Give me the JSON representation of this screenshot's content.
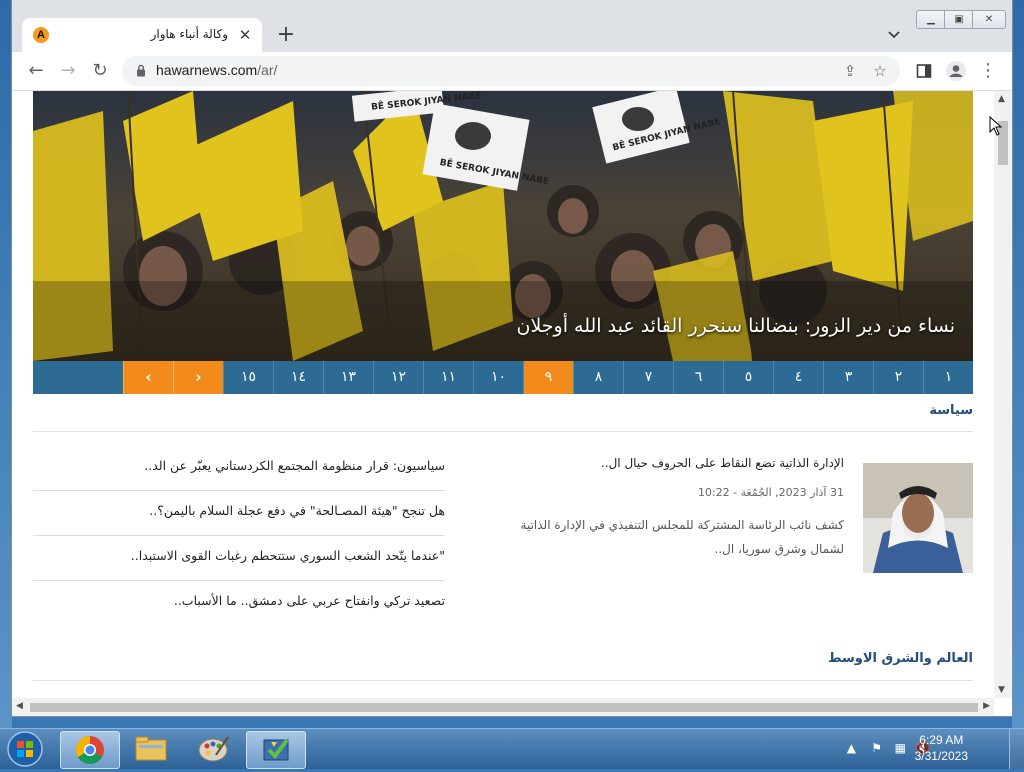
{
  "browser": {
    "tab_title": "وكالة أنباء هاوار",
    "favicon_letter": "A",
    "url_host": "hawarnews.com",
    "url_path": "/ar/"
  },
  "hero": {
    "caption": "نساء من دير الزور: بنضالنا سنحرر القائد عبد الله أوجلان",
    "sign_text": [
      "BÊ SEROK JIYAN NABE",
      "BÊ SEROK JIYAN NABE",
      "BÊ SEROK JIYAN NABE"
    ],
    "pager": [
      "١",
      "٢",
      "٣",
      "٤",
      "٥",
      "٦",
      "٧",
      "٨",
      "٩",
      "١٠",
      "١١",
      "١٢",
      "١٣",
      "١٤",
      "١٥"
    ],
    "active_page": "٩",
    "next_label": "›",
    "prev_label": "‹",
    "colors": {
      "accent": "#f28a1c",
      "pager_bg": "#2e6b94"
    }
  },
  "politics": {
    "title": "سياسة",
    "feature": {
      "title": "الإدارة الذاتية تضع النقاط على الحروف حيال ال..",
      "date": "31 آذار 2023, الجُمُعَة - 10:22",
      "summary": "كشف نائب الرئاسة المشتركة للمجلس التنفيذي في الإدارة الذاتية لشمال وشرق سوريا، ال.."
    },
    "list": [
      "سياسيون: قرار منظومة المجتمع الكردستاني يعبّر عن الد..",
      "هل تنجح \"هيئة المصـالحة\" في دفع عجلة السلام باليمن؟..",
      "\"عندما يتّحد الشعب السوري ستتحطم رغبات القوى الاستبدا..",
      "تصعيد تركي وانفتاح عربي على دمشق.. ما الأسباب.."
    ]
  },
  "world": {
    "title": "العالم والشرق الاوسط"
  },
  "taskbar": {
    "time": "6:29 AM",
    "date": "3/31/2023"
  }
}
